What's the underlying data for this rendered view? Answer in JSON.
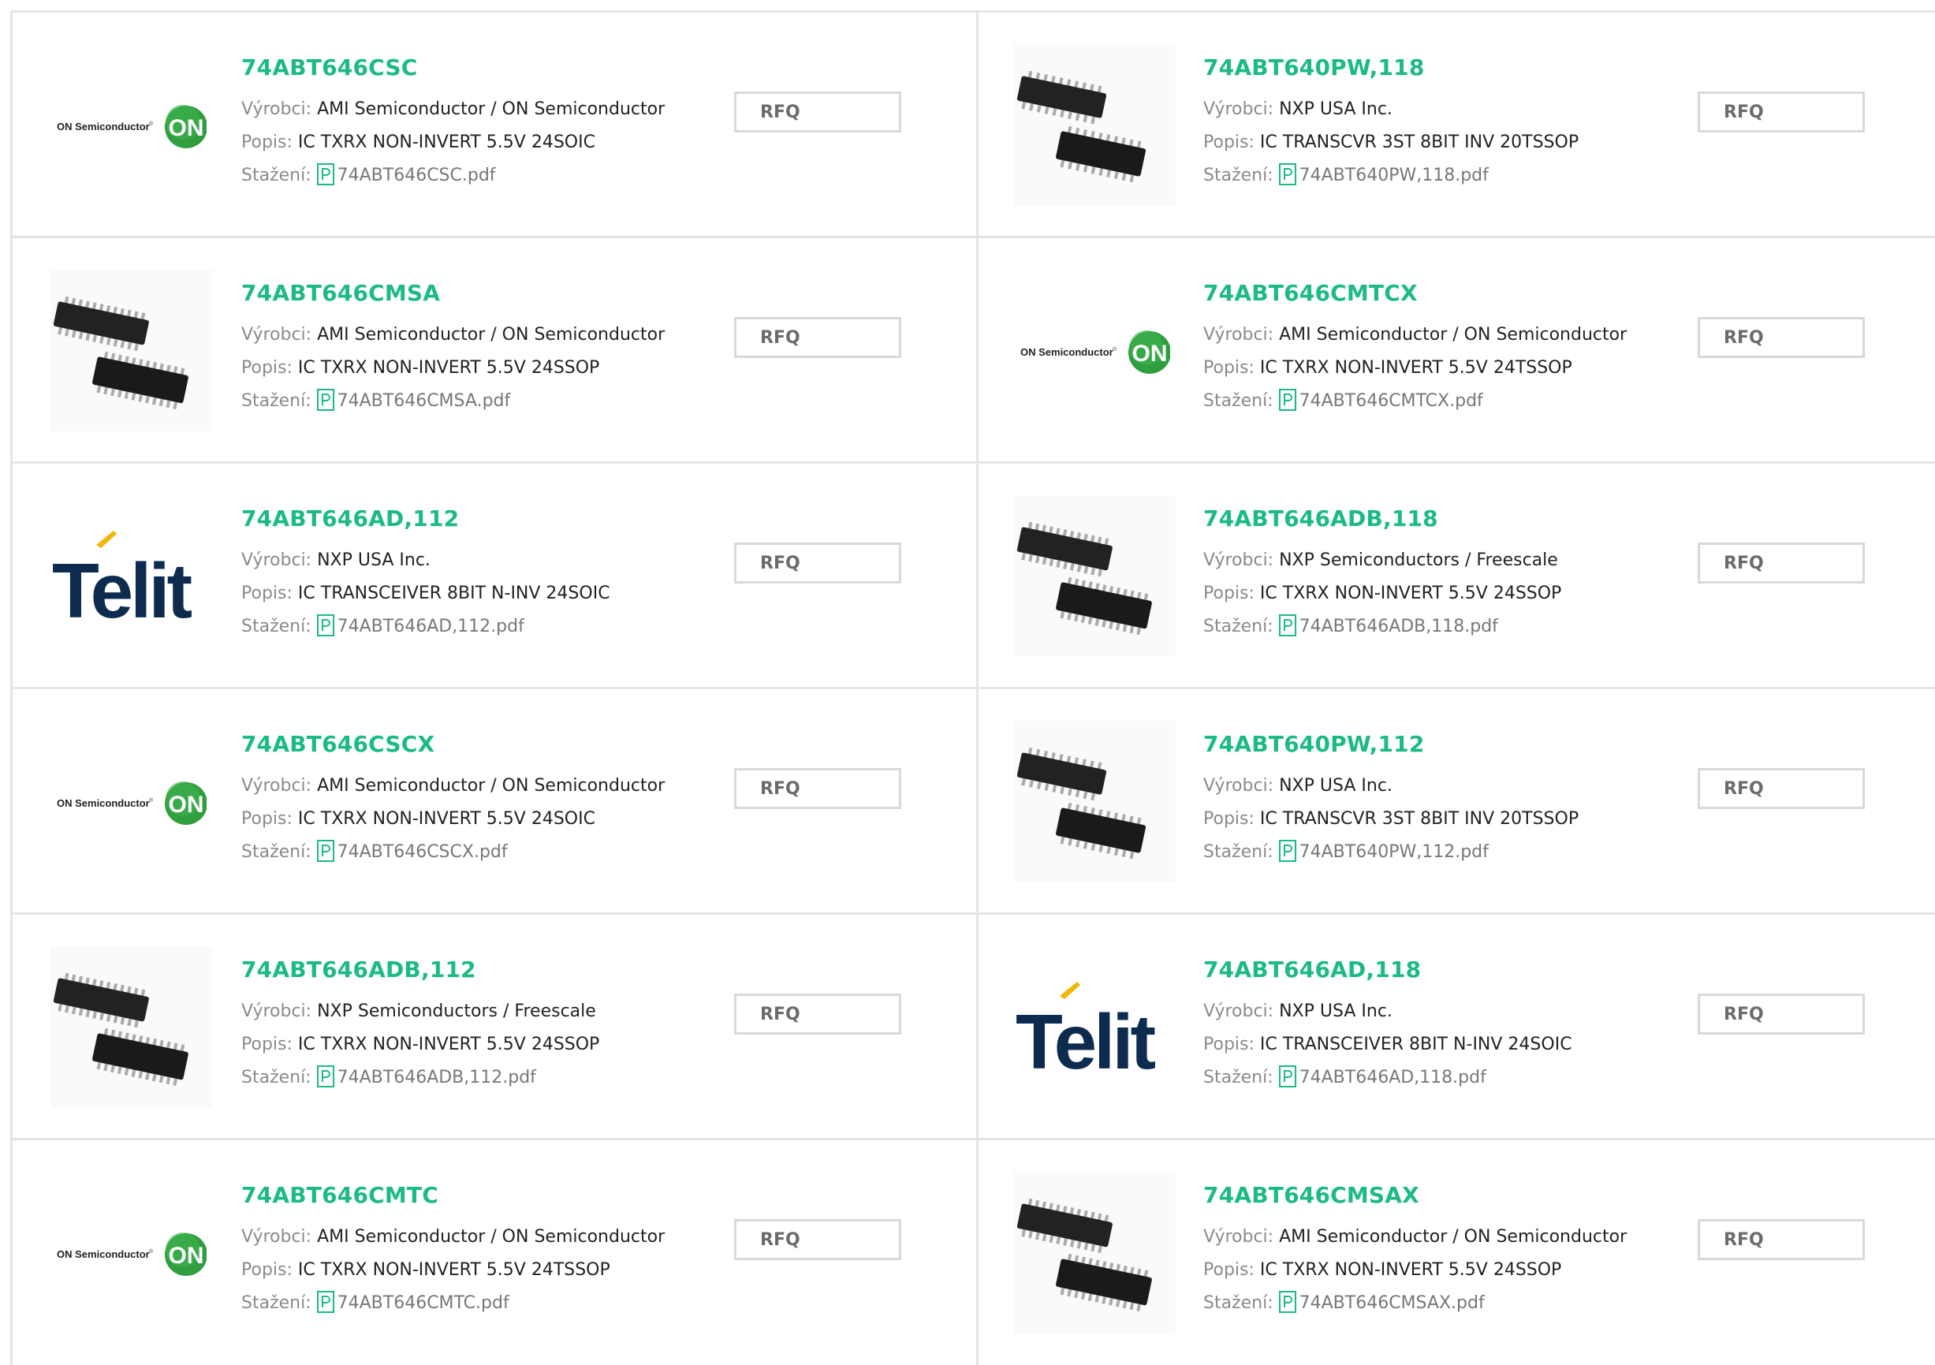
{
  "labels": {
    "manufacturer": "Výrobci:",
    "description": "Popis:",
    "download": "Stažení:",
    "rfq": "RFQ"
  },
  "colors": {
    "accent": "#1cba86",
    "border": "#e4e4e4",
    "on_green": "#2f9e3e",
    "telit_navy": "#0d2b4e",
    "telit_yellow": "#f2b705"
  },
  "products": [
    {
      "part": "74ABT646CSC",
      "manufacturer": "AMI Semiconductor / ON Semiconductor",
      "description": "IC TXRX NON-INVERT 5.5V 24SOIC",
      "file": "74ABT646CSC.pdf",
      "image": "on-semiconductor-logo"
    },
    {
      "part": "74ABT640PW,118",
      "manufacturer": "NXP USA Inc.",
      "description": "IC TRANSCVR 3ST 8BIT INV 20TSSOP",
      "file": "74ABT640PW,118.pdf",
      "image": "tssop-chip-photo"
    },
    {
      "part": "74ABT646CMSA",
      "manufacturer": "AMI Semiconductor / ON Semiconductor",
      "description": "IC TXRX NON-INVERT 5.5V 24SSOP",
      "file": "74ABT646CMSA.pdf",
      "image": "ssop-chip-photo"
    },
    {
      "part": "74ABT646CMTCX",
      "manufacturer": "AMI Semiconductor / ON Semiconductor",
      "description": "IC TXRX NON-INVERT 5.5V 24TSSOP",
      "file": "74ABT646CMTCX.pdf",
      "image": "on-semiconductor-logo"
    },
    {
      "part": "74ABT646AD,112",
      "manufacturer": "NXP USA Inc.",
      "description": "IC TRANSCEIVER 8BIT N-INV 24SOIC",
      "file": "74ABT646AD,112.pdf",
      "image": "telit-logo"
    },
    {
      "part": "74ABT646ADB,118",
      "manufacturer": "NXP Semiconductors / Freescale",
      "description": "IC TXRX NON-INVERT 5.5V 24SSOP",
      "file": "74ABT646ADB,118.pdf",
      "image": "ssop-chip-photo"
    },
    {
      "part": "74ABT646CSCX",
      "manufacturer": "AMI Semiconductor / ON Semiconductor",
      "description": "IC TXRX NON-INVERT 5.5V 24SOIC",
      "file": "74ABT646CSCX.pdf",
      "image": "on-semiconductor-logo"
    },
    {
      "part": "74ABT640PW,112",
      "manufacturer": "NXP USA Inc.",
      "description": "IC TRANSCVR 3ST 8BIT INV 20TSSOP",
      "file": "74ABT640PW,112.pdf",
      "image": "tssop-chip-photo"
    },
    {
      "part": "74ABT646ADB,112",
      "manufacturer": "NXP Semiconductors / Freescale",
      "description": "IC TXRX NON-INVERT 5.5V 24SSOP",
      "file": "74ABT646ADB,112.pdf",
      "image": "ssop-chip-photo"
    },
    {
      "part": "74ABT646AD,118",
      "manufacturer": "NXP USA Inc.",
      "description": "IC TRANSCEIVER 8BIT N-INV 24SOIC",
      "file": "74ABT646AD,118.pdf",
      "image": "telit-logo"
    },
    {
      "part": "74ABT646CMTC",
      "manufacturer": "AMI Semiconductor / ON Semiconductor",
      "description": "IC TXRX NON-INVERT 5.5V 24TSSOP",
      "file": "74ABT646CMTC.pdf",
      "image": "on-semiconductor-logo"
    },
    {
      "part": "74ABT646CMSAX",
      "manufacturer": "AMI Semiconductor / ON Semiconductor",
      "description": "IC TXRX NON-INVERT 5.5V 24SSOP",
      "file": "74ABT646CMSAX.pdf",
      "image": "ssop-chip-photo"
    }
  ],
  "logo_text": {
    "on_semi": "ON Semiconductor",
    "on_badge": "ON",
    "telit": "Telit"
  }
}
